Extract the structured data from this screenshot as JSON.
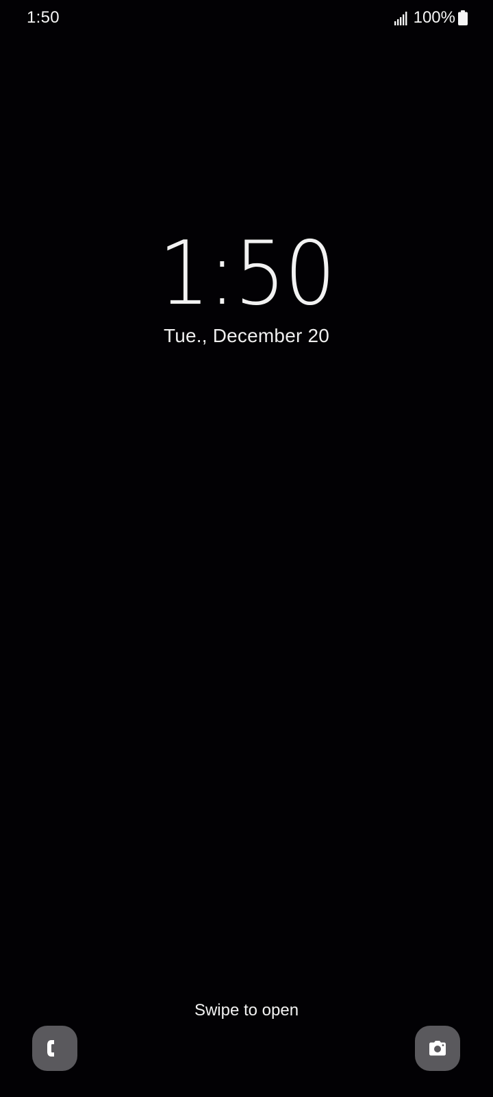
{
  "status_bar": {
    "time": "1:50",
    "battery_percent": "100%",
    "icons": [
      "signal-icon",
      "battery-icon"
    ]
  },
  "lock_screen": {
    "clock": "1:50",
    "date": "Tue., December 20",
    "swipe_hint": "Swipe to open",
    "shortcuts": [
      {
        "name": "phone",
        "icon": "phone-icon"
      },
      {
        "name": "camera",
        "icon": "camera-icon"
      }
    ]
  },
  "colors": {
    "background": "#020104",
    "text": "#ffffff",
    "shortcut_bg": "#5a595d"
  }
}
